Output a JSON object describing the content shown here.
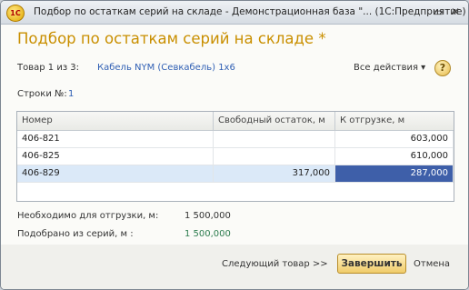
{
  "window": {
    "title": "Подбор по остаткам серий на складе - Демонстрационная база \"... (1С:Предприятие)",
    "logo_text": "1С",
    "controls": {
      "minimize": "▭",
      "close": "✕"
    }
  },
  "form": {
    "title": "Подбор по остаткам серий на складе *",
    "item_counter": "Товар 1 из 3:",
    "item_name": "Кабель NYM (Севкабель) 1х6",
    "all_actions": "Все действия ▾",
    "help": "?",
    "rows_label": "Строки №:",
    "rows_value": "1"
  },
  "table": {
    "columns": [
      "Номер",
      "Свободный остаток, м",
      "К отгрузке, м"
    ],
    "rows": [
      {
        "number": "406-821",
        "free": "",
        "ship": "603,000",
        "selected": false
      },
      {
        "number": "406-825",
        "free": "",
        "ship": "610,000",
        "selected": false
      },
      {
        "number": "406-829",
        "free": "317,000",
        "ship": "287,000",
        "selected": true
      }
    ]
  },
  "summary": {
    "needed_label": "Необходимо для отгрузки, м:",
    "needed_value": "1 500,000",
    "picked_label": "Подобрано из серий, м :",
    "picked_value": "1 500,000",
    "picked_color": "#2e7d4f"
  },
  "footer": {
    "next_button": "Следующий товар >>",
    "finish_button": "Завершить",
    "cancel_button": "Отмена"
  }
}
